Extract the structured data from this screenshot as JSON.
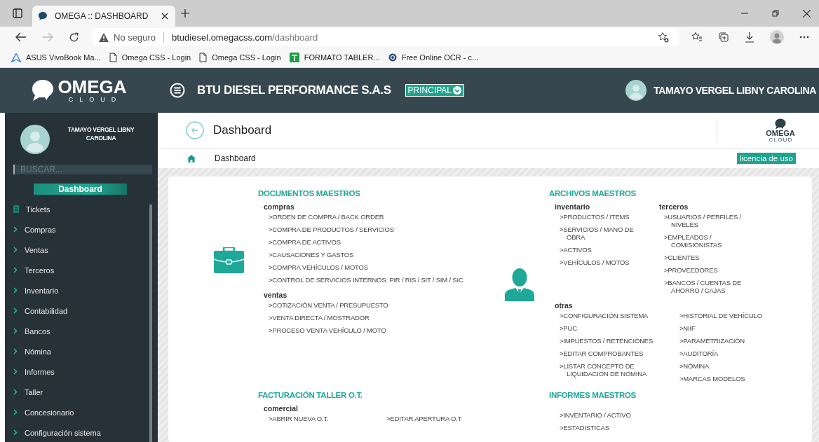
{
  "browser": {
    "tab_title": "OMEGA :: DASHBOARD",
    "security": "No seguro",
    "url_host": "btudiesel.omegacss.com",
    "url_path": "/dashboard",
    "bookmarks": [
      {
        "label": "ASUS VivoBook Ma...",
        "kind": "asus"
      },
      {
        "label": "Omega CSS - Login",
        "kind": "page"
      },
      {
        "label": "Omega CSS - Login",
        "kind": "page"
      },
      {
        "label": "FORMATO TABLER...",
        "kind": "sheet"
      },
      {
        "label": "Free Online OCR - c...",
        "kind": "ocr"
      }
    ]
  },
  "header": {
    "logo_name": "OMEGA",
    "logo_tagline": "CLOUD",
    "company": "BTU DIESEL PERFORMANCE S.A.S",
    "branch": "PRINCIPAL",
    "user_name": "TAMAYO VERGEL LIBNY CAROLINA"
  },
  "sidebar": {
    "user_name": "TAMAYO VERGEL LIBNY CAROLINA",
    "search": {
      "placeholder": "BUSCAR..."
    },
    "active_button": "Dashboard",
    "items": [
      {
        "label": "Tickets",
        "kind": "clipboard"
      },
      {
        "label": "Compras",
        "kind": "submenu"
      },
      {
        "label": "Ventas",
        "kind": "submenu"
      },
      {
        "label": "Terceros",
        "kind": "submenu"
      },
      {
        "label": "Inventario",
        "kind": "submenu"
      },
      {
        "label": "Contabilidad",
        "kind": "submenu"
      },
      {
        "label": "Bancos",
        "kind": "submenu"
      },
      {
        "label": "Nómina",
        "kind": "submenu"
      },
      {
        "label": "Informes",
        "kind": "submenu"
      },
      {
        "label": "Taller",
        "kind": "submenu"
      },
      {
        "label": "Concesionario",
        "kind": "submenu"
      },
      {
        "label": "Configuración sistema",
        "kind": "submenu"
      }
    ]
  },
  "page": {
    "title": "Dashboard",
    "logo_name": "OMEGA",
    "logo_tagline": "CLOUD",
    "breadcrumb": "Dashboard",
    "license": "licencia de uso"
  },
  "sections": [
    {
      "title": "DOCUMENTOS MAESTROS",
      "kind": "briefcase",
      "rows": [
        [
          {
            "label": "compras",
            "columns": [
              [
                ">ORDEN DE COMPRA / BACK ORDER",
                ">COMPRA DE PRODUCTOS / SERVICIOS",
                ">COMPRA DE ACTIVOS",
                ">CAUSACIONES Y GASTOS",
                ">COMPRA VEHÍCULOS / MOTOS",
                ">CONTROL DE SERVICIOS INTERNOS: PIR / RIS / SIT / SIM / SIC"
              ]
            ]
          }
        ],
        [
          {
            "label": "ventas",
            "columns": [
              [
                ">COTIZACIÓN VENTA / PRESUPUESTO",
                ">VENTA DIRECTA / MOSTRADOR",
                ">PROCESO VENTA VEHÍCULO / MOTO"
              ]
            ]
          }
        ]
      ]
    },
    {
      "title": "ARCHIVOS MAESTROS",
      "kind": "person",
      "rows": [
        [
          {
            "label": "inventario",
            "columns": [
              [
                ">PRODUCTOS / ITEMS",
                ">SERVICIOS / MANO DE OBRA",
                ">ACTIVOS",
                ">VEHÍCULOS / MOTOS"
              ]
            ]
          },
          {
            "label": "terceros",
            "columns": [
              [
                ">USUARIOS / PERFILES / NIVELES",
                ">EMPLEADOS / COMISIONISTAS",
                ">CLIENTES",
                ">PROVEEDORES",
                ">BANCOS / CUENTAS DE AHORRO / CAJAS"
              ]
            ]
          }
        ],
        [
          {
            "label": "otras",
            "columns": [
              [
                ">CONFIGURACIÓN SISTEMA",
                ">PUC",
                ">IMPUESTOS / RETENCIONES",
                ">EDITAR COMPROBANTES",
                ">LISTAR CONCEPTO DE LIQUIDACIÓN DE NÓMINA"
              ],
              [
                ">HISTORIAL DE VEHÍCULO",
                ">NIIF",
                ">PARAMETRIZACIÓN",
                ">AUDITORÍA",
                ">NÓMINA",
                ">MARCAS MODELOS"
              ]
            ]
          }
        ]
      ]
    },
    {
      "title": "FACTURACIÓN TALLER O.T.",
      "rows": [
        [
          {
            "label": "comercial",
            "columns": [
              [
                ">ABRIR NUEVA O.T."
              ],
              [
                ">EDITAR APERTURA O.T"
              ]
            ]
          }
        ]
      ]
    },
    {
      "title": "INFORMES MAESTROS",
      "rows": [
        [
          {
            "columns": [
              [
                ">INVENTARIO / ACTIVO",
                ">ESTADISTICAS"
              ]
            ]
          }
        ]
      ]
    }
  ]
}
